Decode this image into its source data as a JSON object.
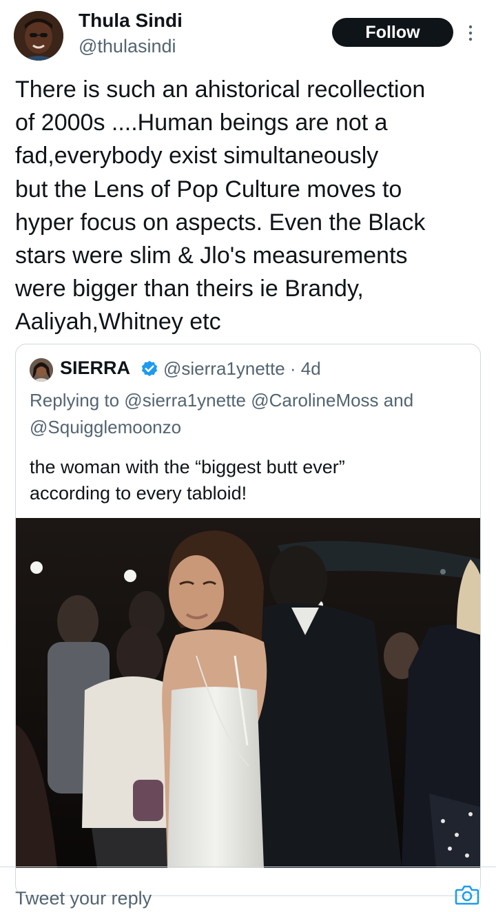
{
  "author": {
    "name": "Thula Sindi",
    "handle": "@thulasindi",
    "avatar": "avatar-photo"
  },
  "follow_label": "Follow",
  "tweet": {
    "text": "There is such an ahistorical recollection\nof 2000s ....Human beings are not a\nfad,everybody exist simultaneously\nbut the Lens of Pop Culture moves to\nhyper focus on aspects. Even the Black\nstars were slim & Jlo's measurements\nwere bigger than theirs ie Brandy,\nAaliyah,Whitney etc"
  },
  "quote": {
    "name": "SIERRA",
    "handle": "@sierra1ynette",
    "time": "4d",
    "handle_time": "@sierra1ynette · 4d",
    "reply_to": "Replying to @sierra1ynette @CarolineMoss and @Squigglemoonzo",
    "text": "the woman with the “biggest butt ever”\naccording to every tabloid!",
    "verified_color": "#1d9bf0",
    "image": "event-photo"
  },
  "reply": {
    "placeholder": "Tweet your reply"
  },
  "icons": {
    "more": "more-vertical-icon",
    "verified": "verified-badge-icon",
    "camera": "camera-icon"
  },
  "colors": {
    "text": "#0f1419",
    "secondary": "#536471",
    "border": "#cfd9de",
    "follow_bg": "#0f1419",
    "accent": "#1d9bf0"
  }
}
